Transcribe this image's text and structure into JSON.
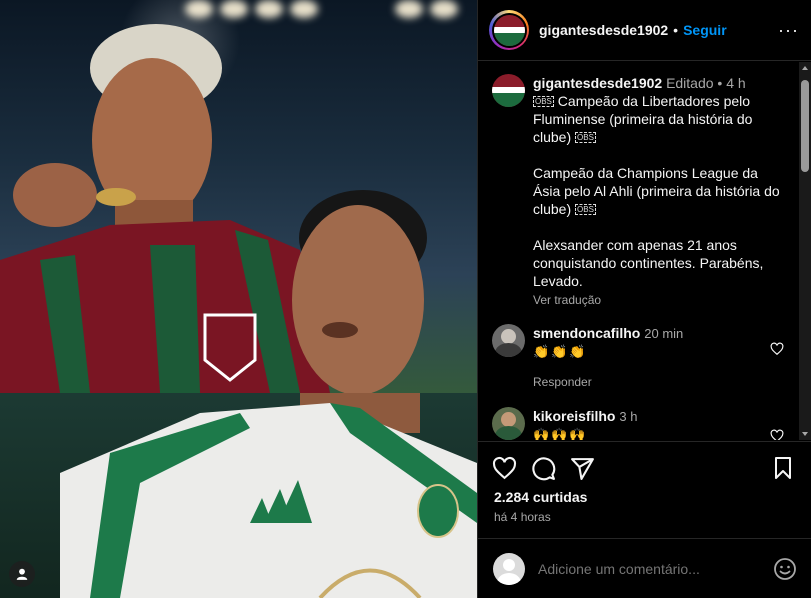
{
  "post": {
    "username": "gigantesdesde1902",
    "follow_label": "Seguir",
    "separator": "•",
    "more_label": "···"
  },
  "caption": {
    "username": "gigantesdesde1902",
    "meta": "Editado • 4 h",
    "line1": " Campeão da Libertadores pelo Fluminense (primeira da história do clube) ",
    "line2": "Campeão da Champions League da Ásia pelo Al Ahli (primeira da história do clube) ",
    "line3": "Alexsander com apenas 21 anos conquistando continentes. Parabéns, Levado.",
    "obs_glyph": "OBS",
    "see_translation": "Ver tradução"
  },
  "comments": [
    {
      "username": "smendoncafilho",
      "time": "20 min",
      "text": "👏👏👏",
      "reply_label": "Responder"
    },
    {
      "username": "kikoreisfilho",
      "time": "3 h",
      "text": "🙌🙌🙌"
    }
  ],
  "actions": {
    "likes": "2.284 curtidas",
    "time_ago": "há 4 horas"
  },
  "add_comment": {
    "placeholder": "Adicione um comentário..."
  },
  "colors": {
    "accent": "#0095f6",
    "muted": "#a8a8a8",
    "fluminense_red": "#8b1c2a",
    "fluminense_green": "#1c6b3e"
  }
}
